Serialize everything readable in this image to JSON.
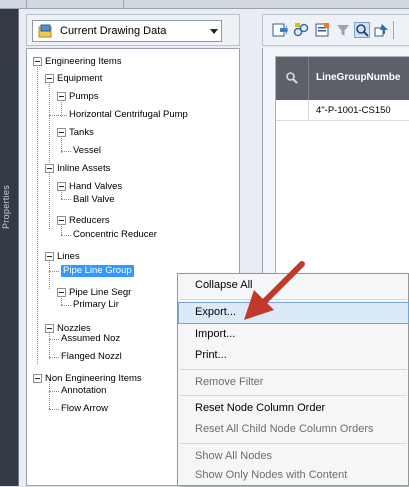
{
  "side_panel": {
    "label": "Properties"
  },
  "drawing_selector": {
    "value": "Current Drawing Data"
  },
  "tree": {
    "nodes": [
      "Engineering Items",
      "Equipment",
      "Pumps",
      "Horizontal Centrifugal Pump",
      "Tanks",
      "Vessel",
      "Inline Assets",
      "Hand Valves",
      "Ball Valve",
      "Reducers",
      "Concentric Reducer",
      "Lines",
      "Pipe Line Group",
      "Pipe Line Segr",
      "Primary Lir",
      "Nozzles",
      "Assumed Noz",
      "Flanged Nozzl",
      "Non Engineering Items",
      "Annotation",
      "Flow Arrow"
    ]
  },
  "grid": {
    "column_header": "LineGroupNumbe",
    "rows": [
      "4\"-P-1001-CS150"
    ]
  },
  "context_menu": {
    "items": [
      "Collapse All",
      "Export...",
      "Import...",
      "Print...",
      "Remove Filter",
      "Reset Node Column Order",
      "Reset All Child Node Column Orders",
      "Show All Nodes",
      "Show Only Nodes with Content"
    ]
  },
  "colors": {
    "selection": "#3399ff",
    "menu_highlight": "#dbe9f9",
    "annotation_arrow": "#c0392b",
    "grid_header": "#5c6068"
  },
  "icons": {
    "drawing_selector": "drawing-data-icon",
    "grid_header": "search-icon",
    "annotation": "red-arrow-icon"
  }
}
